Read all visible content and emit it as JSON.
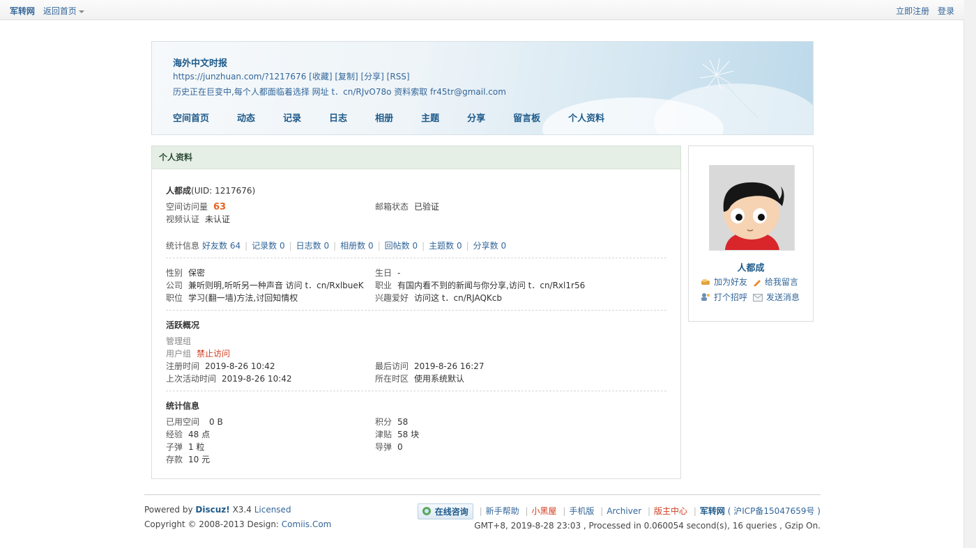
{
  "topbar": {
    "site": "军转网",
    "home": "返回首页",
    "register": "立即注册",
    "login": "登录"
  },
  "header": {
    "title": "海外中文时报",
    "url_line": "https://junzhuan.com/?1217676 [收藏] [复制] [分享] [RSS]",
    "desc": "历史正在巨变中,每个人都面临着选择 网址 t．cn/RJvO78o 资料索取 fr45tr@gmail.com",
    "nav": [
      "空间首页",
      "动态",
      "记录",
      "日志",
      "相册",
      "主题",
      "分享",
      "留言板",
      "个人资料"
    ]
  },
  "profile": {
    "box_title": "个人资料",
    "name": "人都成",
    "uid": "(UID: 1217676)",
    "visits_label": "空间访问量",
    "visits": "63",
    "email_label": "邮箱状态",
    "email": "已验证",
    "video_label": "视频认证",
    "video": "未认证",
    "stats_label": "统计信息",
    "stats": [
      "好友数 64",
      "记录数 0",
      "日志数 0",
      "相册数 0",
      "回帖数 0",
      "主题数 0",
      "分享数 0"
    ],
    "gender_label": "性别",
    "gender": "保密",
    "birthday_label": "生日",
    "birthday": "-",
    "company_label": "公司",
    "company": "兼听则明,听听另一种声音 访问 t．cn/RxlbueK",
    "job_label": "职业",
    "job": "有国内看不到的新闻与你分享,访问 t．cn/Rxl1r56",
    "position_label": "职位",
    "position": "学习(翻一墙)方法,讨回知情权",
    "hobby_label": "兴趣爱好",
    "hobby": "访问这 t．cn/RJAQKcb",
    "activity_title": "活跃概况",
    "admin_group_label": "管理组",
    "user_group_label": "用户组",
    "user_group": "禁止访问",
    "reg_label": "注册时间",
    "reg": "2019-8-26 10:42",
    "last_visit_label": "最后访问",
    "last_visit": "2019-8-26 16:27",
    "last_active_label": "上次活动时间",
    "last_active": "2019-8-26 10:42",
    "tz_label": "所在时区",
    "tz": "使用系统默认",
    "stat_title": "统计信息",
    "space_label": "已用空间",
    "space": "0 B",
    "points_label": "积分",
    "points": "58",
    "exp_label": "经验",
    "exp": "48 点",
    "subsidy_label": "津贴",
    "subsidy": "58 块",
    "bullet_label": "子弹",
    "bullet": "1 粒",
    "missile_label": "导弹",
    "missile": "0",
    "deposit_label": "存款",
    "deposit": "10 元"
  },
  "sidebar": {
    "name": "人都成",
    "add_friend": "加为好友",
    "leave_msg": "给我留言",
    "greet": "打个招呼",
    "send_msg": "发送消息"
  },
  "footer": {
    "powered": "Powered by",
    "discuz": "Discuz!",
    "version": "X3.4",
    "licensed": "Licensed",
    "copyright": "Copyright © 2008-2013 Design:",
    "design": "Comiis.Com",
    "consult": "在线咨询",
    "links": [
      "新手帮助",
      "小黑屋",
      "手机版",
      "Archiver",
      "版主中心"
    ],
    "site": "军转网",
    "icp": "( 沪ICP备15047659号 )",
    "stats": "GMT+8, 2019-8-28 23:03 , Processed in 0.060054 second(s), 16 queries , Gzip On."
  }
}
